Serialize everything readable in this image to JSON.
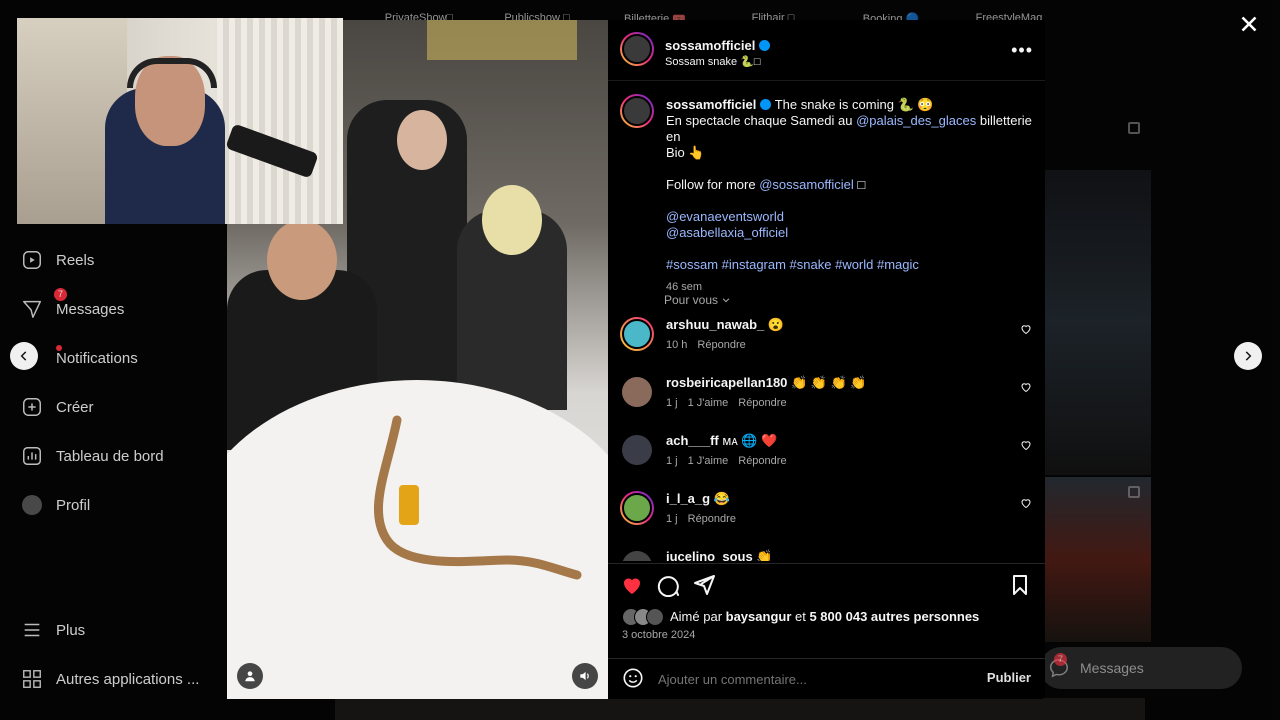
{
  "stories": [
    "PrivateShow□",
    "Publicshow □",
    "Billetterie 🎟️",
    "Flithair □",
    "Booking 🔵",
    "FreestyleMag"
  ],
  "sidebar": {
    "items": [
      {
        "label": "Reels",
        "icon": "reels-icon"
      },
      {
        "label": "Messages",
        "icon": "messages-icon",
        "badge": "7"
      },
      {
        "label": "Notifications",
        "icon": "heart-icon"
      },
      {
        "label": "Créer",
        "icon": "create-icon"
      },
      {
        "label": "Tableau de bord",
        "icon": "dashboard-icon"
      },
      {
        "label": "Profil",
        "icon": "profile-avatar"
      }
    ],
    "more": "Plus",
    "apps": "Autres applications ..."
  },
  "post": {
    "username": "sossamofficiel",
    "subtitle": "Sossam snake 🐍□",
    "caption": {
      "username": "sossamofficiel",
      "line1": "The snake is coming 🐍 😳",
      "line2_pre": "En spectacle chaque Samedi au ",
      "line2_link": "@palais_des_glaces",
      "line2_post": " billetterie en",
      "line3": "Bio 👆",
      "follow_pre": "Follow for more ",
      "follow_link": "@sossamofficiel",
      "follow_post": " □",
      "mention1": "@evanaeventsworld",
      "mention2": "@asabellaxia_officiel",
      "hashtags": "#sossam #instagram #snake #world #magic",
      "age": "46 sem"
    },
    "filter": "Pour vous",
    "comments": [
      {
        "user": "arshuu_nawab_",
        "text": "😮",
        "meta": [
          "10 h",
          "Répondre"
        ]
      },
      {
        "user": "rosbeiricapellan180",
        "text": "👏 👏 👏 👏",
        "meta": [
          "1 j",
          "1 J'aime",
          "Répondre"
        ]
      },
      {
        "user": "ach___ff",
        "text": "ᴍᴀ 🌐 ❤️",
        "meta": [
          "1 j",
          "1 J'aime",
          "Répondre"
        ]
      },
      {
        "user": "i_l_a_g",
        "text": "😂",
        "meta": [
          "1 j",
          "Répondre"
        ]
      },
      {
        "user": "jucelino_sous",
        "text": "👏",
        "meta": []
      }
    ],
    "likes_pre": "Aimé par ",
    "likes_user": "baysangur",
    "likes_mid": " et ",
    "likes_count": "5 800 043 autres personnes",
    "date": "3 octobre 2024",
    "comment_placeholder": "Ajouter un commentaire...",
    "publish": "Publier"
  },
  "background": {
    "messages_label": "Messages",
    "messages_badge": "7"
  },
  "colors": {
    "like_red": "#ff3040",
    "link_blue": "#9bb8ff",
    "verified_blue": "#0095f6"
  }
}
